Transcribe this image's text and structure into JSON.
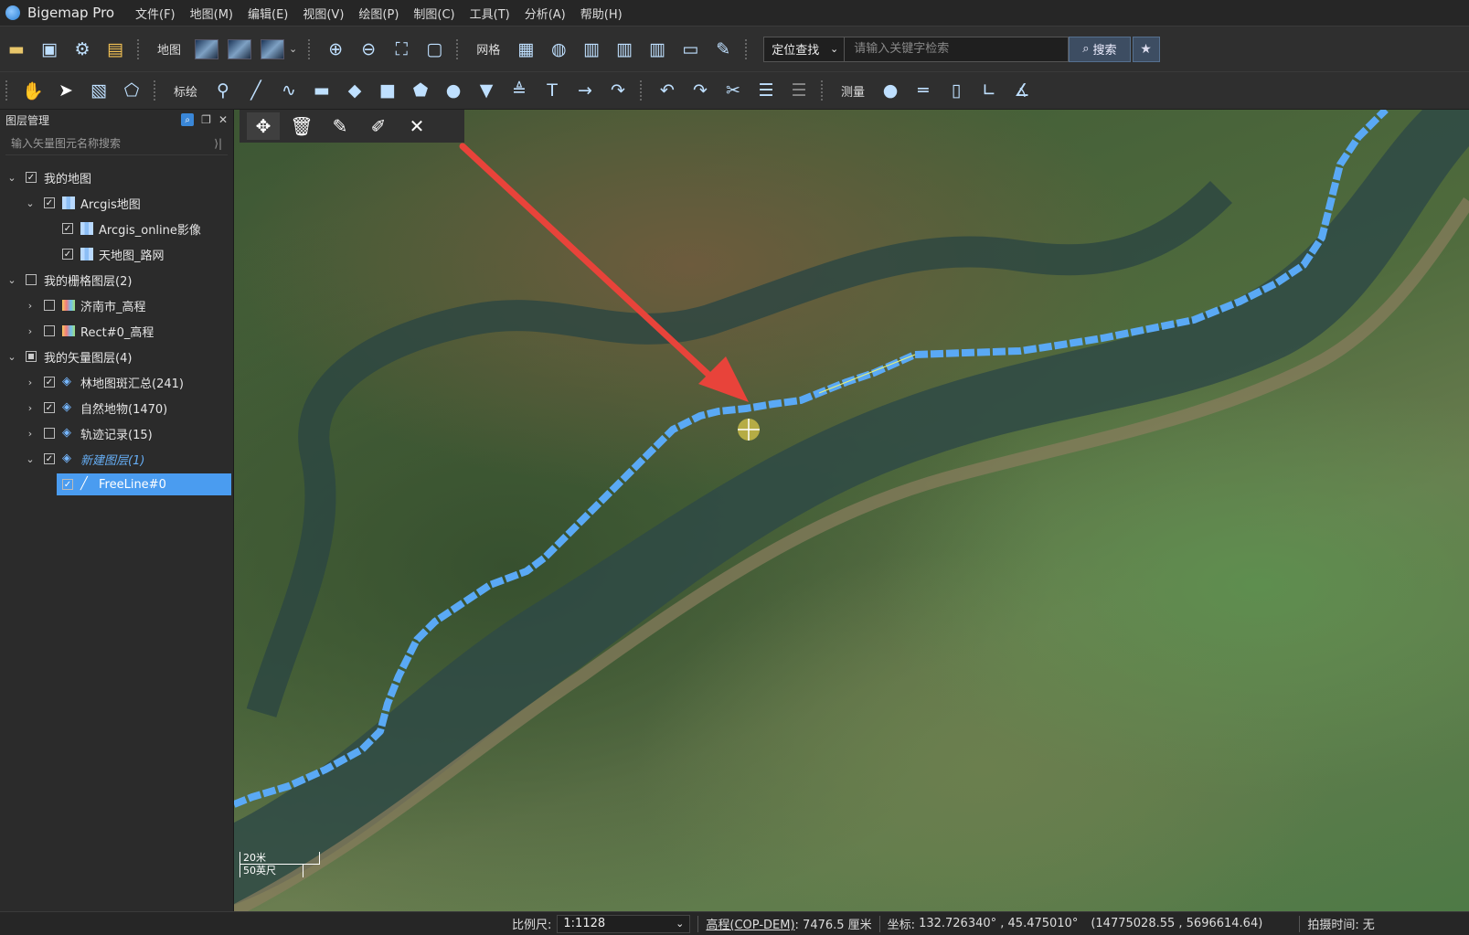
{
  "app": {
    "title": "Bigemap Pro"
  },
  "menu": [
    "文件(F)",
    "地图(M)",
    "编辑(E)",
    "视图(V)",
    "绘图(P)",
    "制图(C)",
    "工具(T)",
    "分析(A)",
    "帮助(H)"
  ],
  "toolbar1": {
    "map_label": "地图",
    "grid_label": "网格",
    "locate_select": "定位查找",
    "search_placeholder": "请输入关键字检索",
    "search_button": "搜索"
  },
  "toolbar2": {
    "draw_label": "标绘",
    "measure_label": "测量"
  },
  "panel": {
    "title": "图层管理",
    "search_placeholder": "输入矢量图元名称搜索",
    "tree": [
      {
        "label": "我的地图",
        "level": 0,
        "expanded": true,
        "checked": "checked",
        "icon": "none"
      },
      {
        "label": "Arcgis地图",
        "level": 1,
        "expanded": true,
        "checked": "checked",
        "icon": "map-icon"
      },
      {
        "label": "Arcgis_online影像",
        "level": 2,
        "checked": "checked",
        "icon": "map-icon"
      },
      {
        "label": "天地图_路网",
        "level": 2,
        "checked": "checked",
        "icon": "map-icon"
      },
      {
        "label": "我的栅格图层(2)",
        "level": 0,
        "expanded": true,
        "checked": "unchecked",
        "icon": "none"
      },
      {
        "label": "济南市_高程",
        "level": 1,
        "expanded": false,
        "checked": "unchecked",
        "icon": "raster-icon"
      },
      {
        "label": "Rect#0_高程",
        "level": 1,
        "expanded": false,
        "checked": "unchecked",
        "icon": "raster-icon"
      },
      {
        "label": "我的矢量图层(4)",
        "level": 0,
        "expanded": true,
        "checked": "partial",
        "icon": "none"
      },
      {
        "label": "林地图斑汇总(241)",
        "level": 1,
        "expanded": false,
        "checked": "checked",
        "icon": "layers-icon"
      },
      {
        "label": "自然地物(1470)",
        "level": 1,
        "expanded": false,
        "checked": "checked",
        "icon": "layers-icon"
      },
      {
        "label": "轨迹记录(15)",
        "level": 1,
        "expanded": false,
        "checked": "unchecked",
        "icon": "layers-icon"
      },
      {
        "label": "新建图层(1)",
        "level": 1,
        "expanded": true,
        "checked": "checked",
        "icon": "layers-icon"
      },
      {
        "label": "FreeLine#0",
        "level": 2,
        "checked": "checked",
        "icon": "line-icon",
        "selected": true
      }
    ]
  },
  "map": {
    "scalebar": {
      "metric": "20米",
      "imperial": "50英尺"
    },
    "line_color": "#5aa9f5",
    "arrow_color": "#e8433a"
  },
  "status": {
    "scale_label": "比例尺:",
    "scale_value": "1:1128",
    "elevation_label": "高程(COP-DEM)",
    "elevation_value": ": 7476.5 厘米",
    "coords_label": "坐标:",
    "coords_value": "132.726340° , 45.475010°",
    "coords_projected": "(14775028.55 , 5696614.64)",
    "capture_label": "拍摄时间:",
    "capture_value": "无"
  }
}
